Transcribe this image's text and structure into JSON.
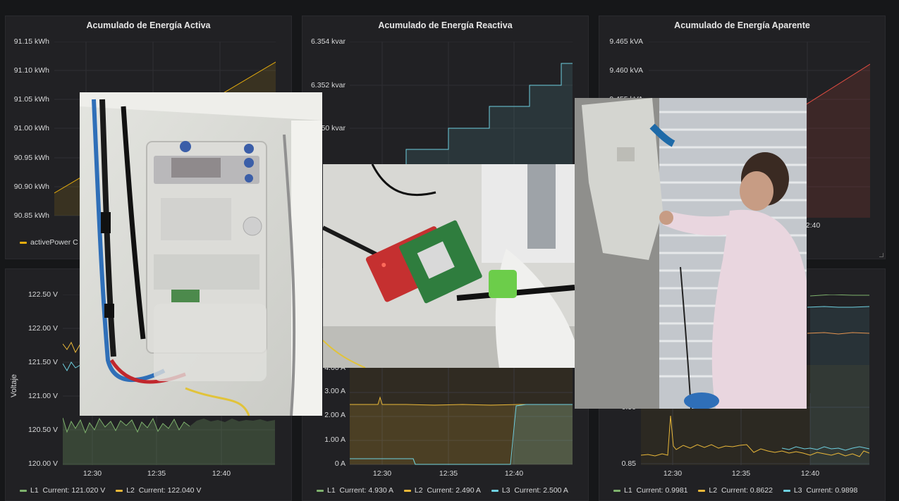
{
  "panels": {
    "active": {
      "title": "Acumulado de Energía Activa",
      "yticks": [
        "91.15 kWh",
        "91.10 kWh",
        "91.05 kWh",
        "91.00 kWh",
        "90.95 kWh",
        "90.90 kWh",
        "90.85 kWh"
      ],
      "legend_name": "activePower",
      "legend_current": "C",
      "color": "#e5ac0e"
    },
    "reactive": {
      "title": "Acumulado de Energía Reactiva",
      "yticks": [
        "6.354 kvar",
        "6.352 kvar",
        "6.350 kvar"
      ],
      "ytick_visible": [
        "6.354 kvar",
        "6.352 kvar",
        "50 kvar"
      ],
      "color": "#6ed0e0"
    },
    "apparent": {
      "title": "Acumulado de Energía Aparente",
      "yticks": [
        "9.465 kVA",
        "9.460 kVA",
        "9.455 kVA"
      ],
      "ytick_visible": [
        "9.465 kVA",
        "9.460 kVA",
        "9.455 kVA"
      ],
      "xtick_visible": "2:40",
      "color": "#e24d42"
    },
    "voltage": {
      "axis_title": "Voltaje",
      "yticks": [
        "122.50 V",
        "122.00 V",
        "121.50 V",
        "121.00 V",
        "120.50 V",
        "120.00 V"
      ],
      "xticks": [
        "12:30",
        "12:35",
        "12:40"
      ],
      "legend": [
        {
          "name": "L1",
          "current": "Current: 121.020 V",
          "color": "#7eb26d"
        },
        {
          "name": "L2",
          "current": "Current: 122.040 V",
          "color": "#eab839"
        }
      ]
    },
    "current": {
      "yticks": [
        "3.00 A",
        "2.00 A",
        "1.00 A",
        "0 A"
      ],
      "ytick_partial": "4.00 A",
      "xticks": [
        "12:30",
        "12:35",
        "12:40"
      ],
      "legend": [
        {
          "name": "L1",
          "current": "Current: 4.930 A",
          "color": "#7eb26d"
        },
        {
          "name": "L2",
          "current": "Current: 2.490 A",
          "color": "#eab839"
        },
        {
          "name": "L3",
          "current": "Current: 2.500 A",
          "color": "#6ed0e0"
        }
      ]
    },
    "pf": {
      "yticks": [
        "0.85"
      ],
      "ytick_partial": "0.90",
      "xticks": [
        "12:30",
        "12:35",
        "12:40"
      ],
      "legend": [
        {
          "name": "L1",
          "current": "Current: 0.9981",
          "color": "#7eb26d"
        },
        {
          "name": "L2",
          "current": "Current: 0.8622",
          "color": "#eab839"
        },
        {
          "name": "L3",
          "current": "Current: 0.9898",
          "color": "#6ed0e0"
        }
      ]
    }
  },
  "photos": {
    "meter": "electric-meter-photo",
    "board": "sensor-board-photo",
    "person": "person-installing-photo"
  }
}
